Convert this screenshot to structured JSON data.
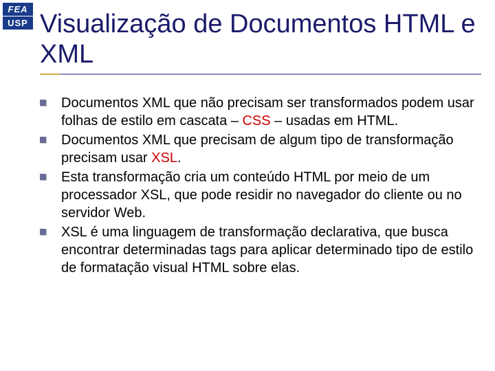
{
  "logo": {
    "top": "FEA",
    "bottom": "USP"
  },
  "title": "Visualização de Documentos HTML e XML",
  "bullets": [
    {
      "pre": "Documentos XML que não precisam ser transformados podem usar folhas de estilo em cascata – ",
      "hl": "CSS",
      "post": " – usadas em HTML."
    },
    {
      "pre": "Documentos XML que precisam de algum tipo de transformação precisam usar ",
      "hl": "XSL",
      "post": "."
    },
    {
      "pre": "Esta transformação cria um conteúdo HTML por meio de um processador XSL, que pode residir no navegador do cliente ou no servidor Web.",
      "hl": "",
      "post": ""
    },
    {
      "pre": "XSL é uma linguagem de transformação declarativa, que busca encontrar determinadas tags para aplicar determinado tipo de estilo de formatação visual HTML sobre elas.",
      "hl": "",
      "post": ""
    }
  ]
}
